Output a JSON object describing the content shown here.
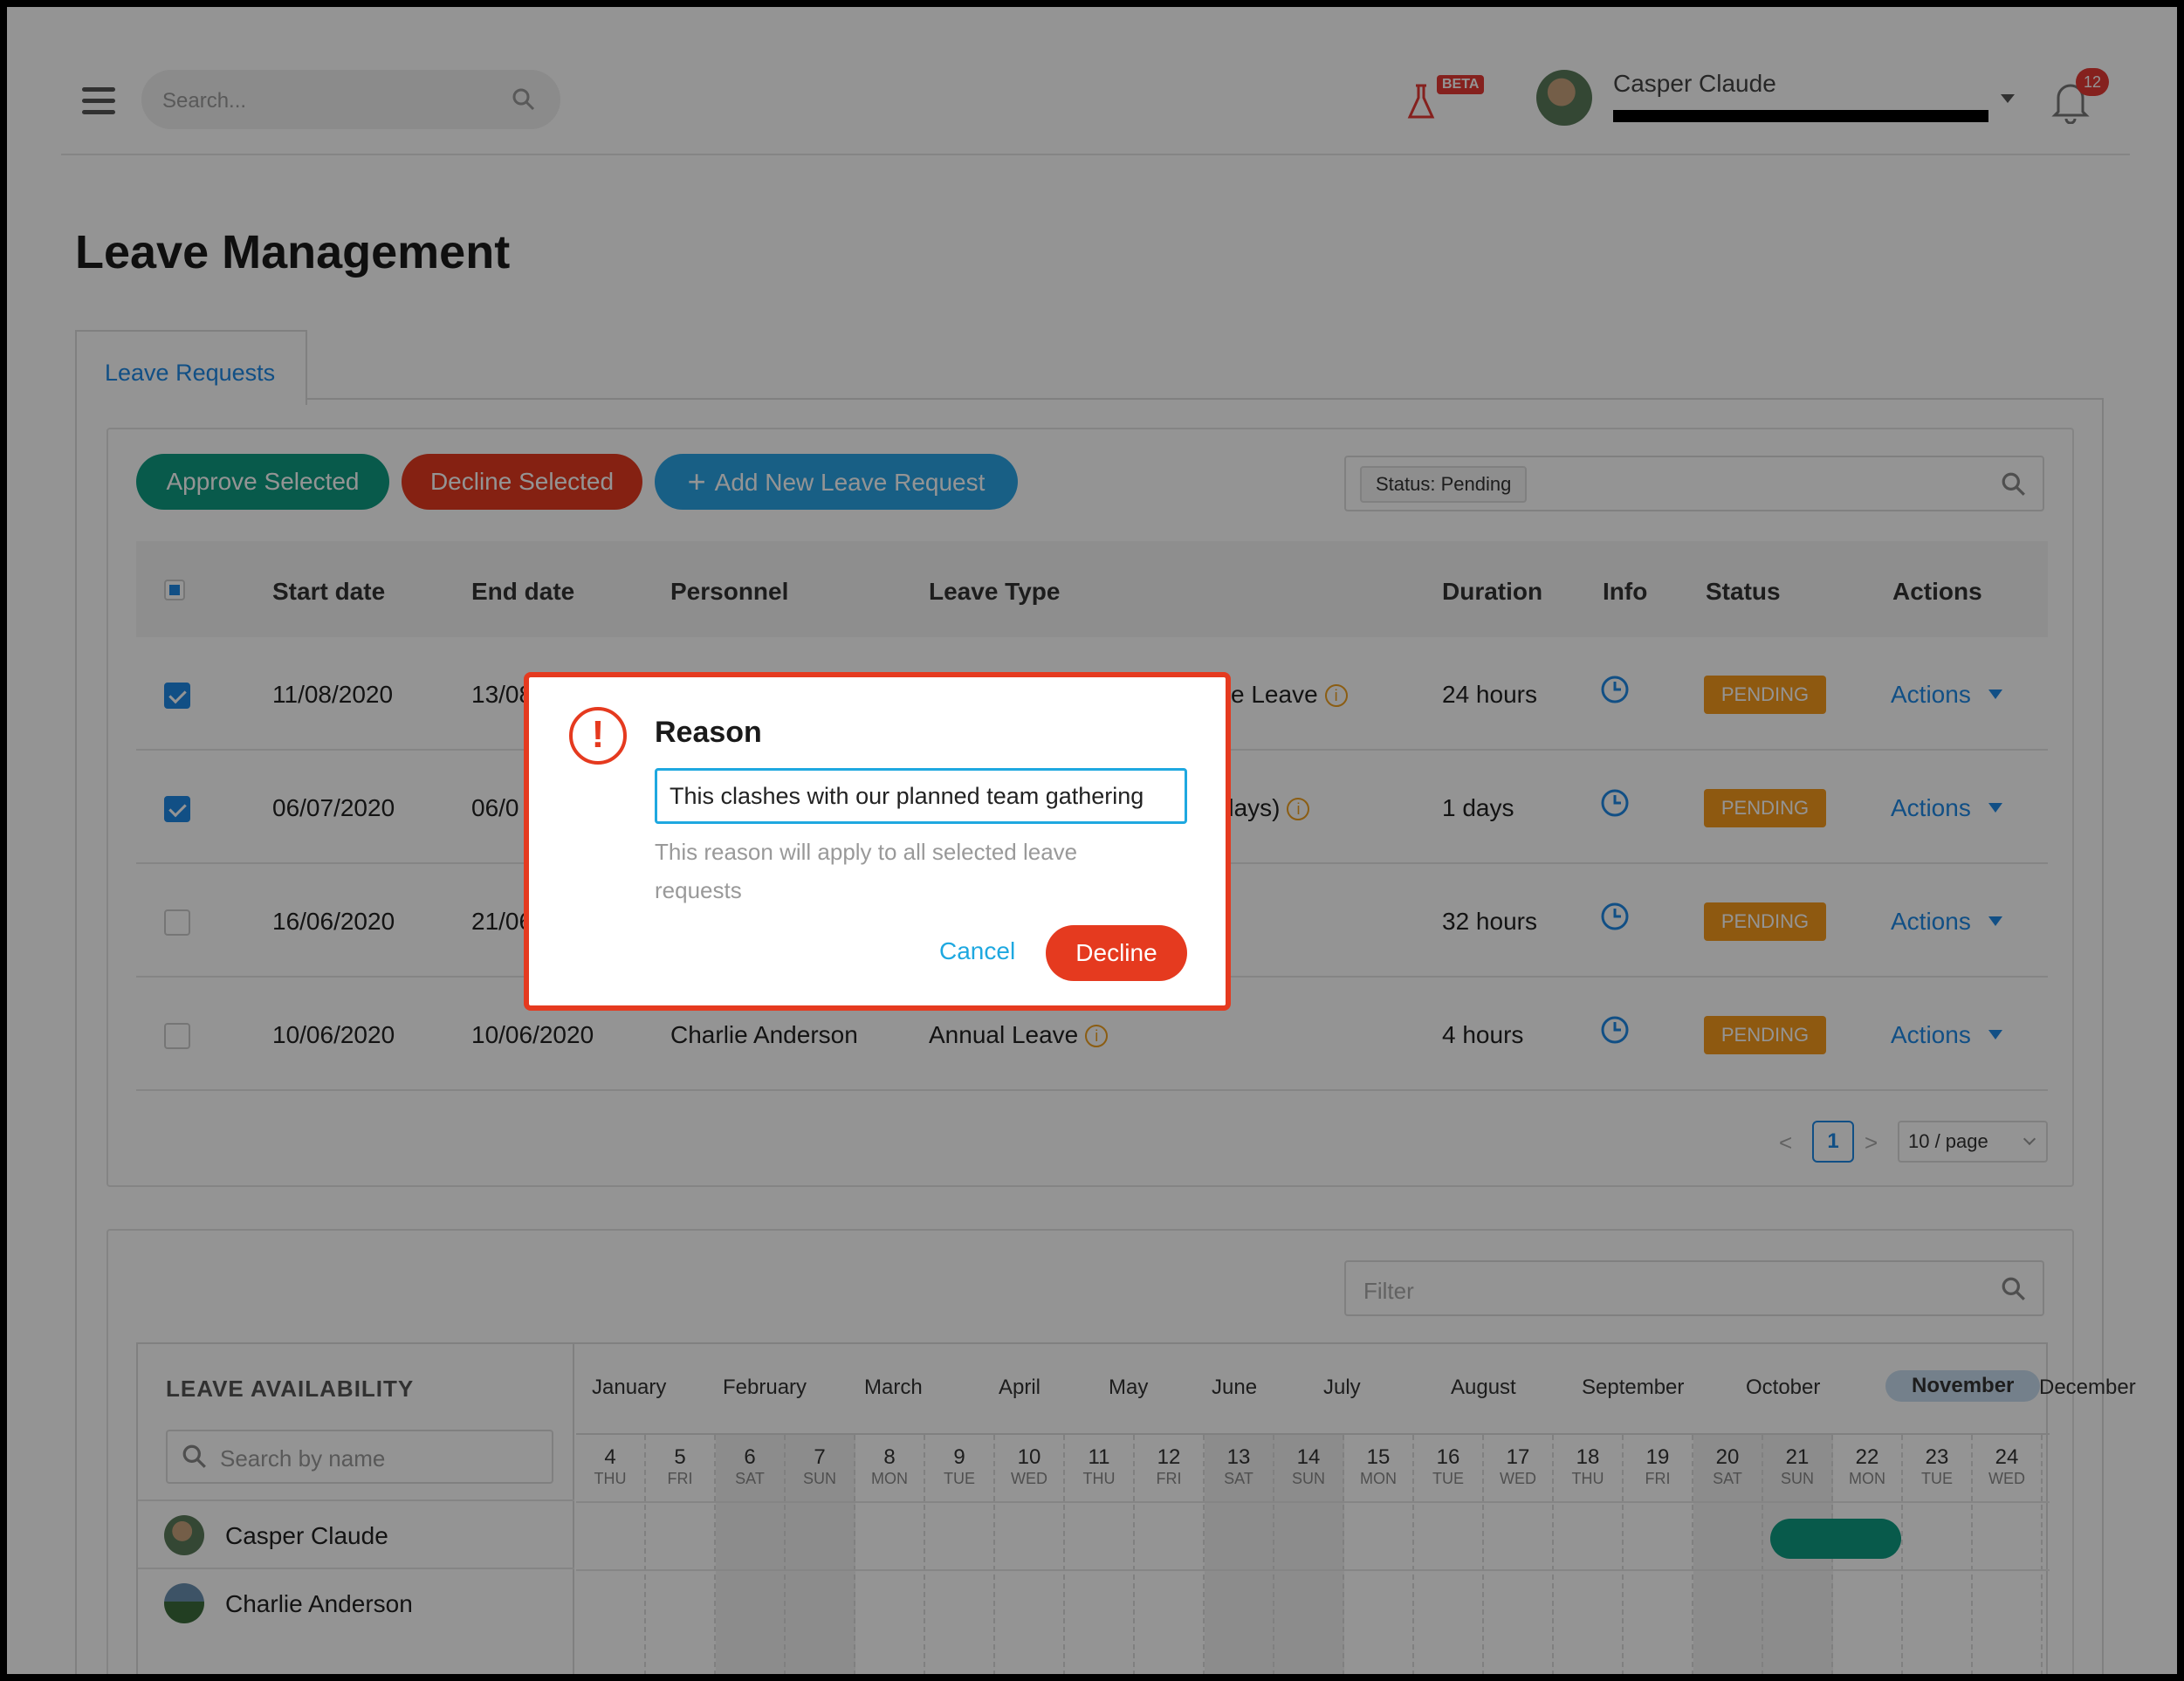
{
  "header": {
    "search_placeholder": "Search...",
    "beta_label": "BETA",
    "user_name": "Casper Claude",
    "notification_count": "12",
    "icons": {
      "menu": "hamburger-icon",
      "search": "search-icon",
      "beta": "flask-icon",
      "notifications": "bell-icon"
    }
  },
  "page": {
    "title": "Leave Management"
  },
  "tabs": [
    {
      "label": "Leave Requests",
      "active": true
    }
  ],
  "toolbar": {
    "approve_label": "Approve Selected",
    "decline_label": "Decline Selected",
    "add_label": "Add New Leave Request",
    "status_chip": "Status: Pending"
  },
  "table": {
    "columns": [
      "Start date",
      "End date",
      "Personnel",
      "Leave Type",
      "Duration",
      "Info",
      "Status",
      "Actions"
    ],
    "rows": [
      {
        "checked": true,
        "start": "11/08/2020",
        "end": "13/08",
        "personnel": "",
        "leave_type": "ce Leave",
        "duration": "24 hours",
        "status": "PENDING",
        "actions": "Actions"
      },
      {
        "checked": true,
        "start": "06/07/2020",
        "end": "06/0",
        "personnel": "",
        "leave_type": "days)",
        "duration": "1 days",
        "status": "PENDING",
        "actions": "Actions"
      },
      {
        "checked": false,
        "start": "16/06/2020",
        "end": "21/06",
        "personnel": "",
        "leave_type": "",
        "duration": "32 hours",
        "status": "PENDING",
        "actions": "Actions"
      },
      {
        "checked": false,
        "start": "10/06/2020",
        "end": "10/06/2020",
        "personnel": "Charlie Anderson",
        "leave_type": "Annual Leave",
        "duration": "4 hours",
        "status": "PENDING",
        "actions": "Actions"
      }
    ]
  },
  "pagination": {
    "prev": "<",
    "current": "1",
    "next": ">",
    "page_size": "10 / page"
  },
  "availability": {
    "filter_placeholder": "Filter",
    "title": "LEAVE AVAILABILITY",
    "search_placeholder": "Search by name",
    "months": [
      "January",
      "February",
      "March",
      "April",
      "May",
      "June",
      "July",
      "August",
      "September",
      "October",
      "November",
      "December"
    ],
    "selected_month": "November",
    "days": [
      {
        "n": "4",
        "w": "THU"
      },
      {
        "n": "5",
        "w": "FRI"
      },
      {
        "n": "6",
        "w": "SAT"
      },
      {
        "n": "7",
        "w": "SUN"
      },
      {
        "n": "8",
        "w": "MON"
      },
      {
        "n": "9",
        "w": "TUE"
      },
      {
        "n": "10",
        "w": "WED"
      },
      {
        "n": "11",
        "w": "THU"
      },
      {
        "n": "12",
        "w": "FRI"
      },
      {
        "n": "13",
        "w": "SAT"
      },
      {
        "n": "14",
        "w": "SUN"
      },
      {
        "n": "15",
        "w": "MON"
      },
      {
        "n": "16",
        "w": "TUE"
      },
      {
        "n": "17",
        "w": "WED"
      },
      {
        "n": "18",
        "w": "THU"
      },
      {
        "n": "19",
        "w": "FRI"
      },
      {
        "n": "20",
        "w": "SAT"
      },
      {
        "n": "21",
        "w": "SUN"
      },
      {
        "n": "22",
        "w": "MON"
      },
      {
        "n": "23",
        "w": "TUE"
      },
      {
        "n": "24",
        "w": "WED"
      }
    ],
    "people": [
      "Casper Claude",
      "Charlie Anderson"
    ]
  },
  "modal": {
    "title": "Reason",
    "input_value": "This clashes with our planned team gathering",
    "help_text": "This reason will apply to all selected leave requests",
    "cancel_label": "Cancel",
    "decline_label": "Decline",
    "icon": "exclamation-circle-icon"
  },
  "colors": {
    "approve": "#0f9b82",
    "decline": "#e53a1f",
    "add": "#2aa4e6",
    "pending": "#f59a1c",
    "link": "#1e88e5"
  }
}
